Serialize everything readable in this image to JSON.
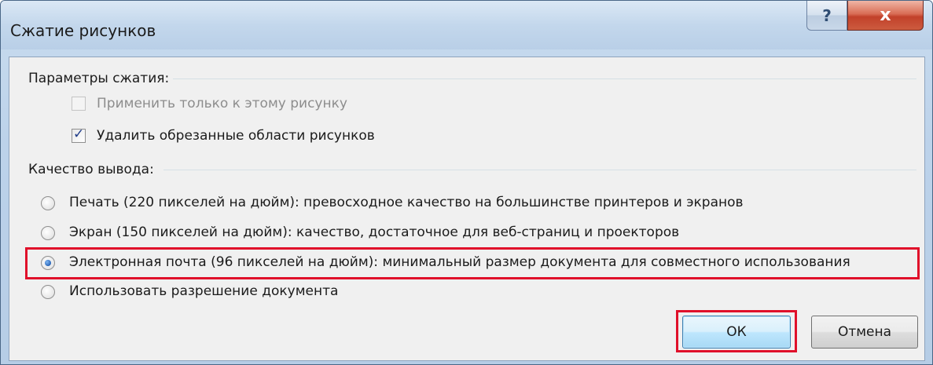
{
  "window": {
    "title": "Сжатие рисунков",
    "help_glyph": "?",
    "close_glyph": "x"
  },
  "compression": {
    "group_label": "Параметры сжатия:",
    "apply_only_label": "Применить только к этому рисунку",
    "apply_only_checked": false,
    "apply_only_enabled": false,
    "delete_cropped_label": "Удалить обрезанные области рисунков",
    "delete_cropped_checked": true
  },
  "quality": {
    "group_label": "Качество вывода:",
    "options": [
      {
        "label": "Печать (220 пикселей на дюйм): превосходное качество на большинстве принтеров и экранов",
        "selected": false
      },
      {
        "label": "Экран (150 пикселей на дюйм): качество, достаточное для веб-страниц и проекторов",
        "selected": false
      },
      {
        "label": "Электронная почта (96 пикселей на дюйм): минимальный размер документа для совместного использования",
        "selected": true
      },
      {
        "label": "Использовать разрешение документа",
        "selected": false
      }
    ]
  },
  "buttons": {
    "ok": "ОК",
    "cancel": "Отмена"
  },
  "colors": {
    "highlight": "#e0102a",
    "radio_selected": "#2a66b8",
    "checkmark": "#1f3c88"
  },
  "icons": {
    "check": "checkmark-icon",
    "help": "question-mark-icon",
    "close": "close-x-icon"
  }
}
